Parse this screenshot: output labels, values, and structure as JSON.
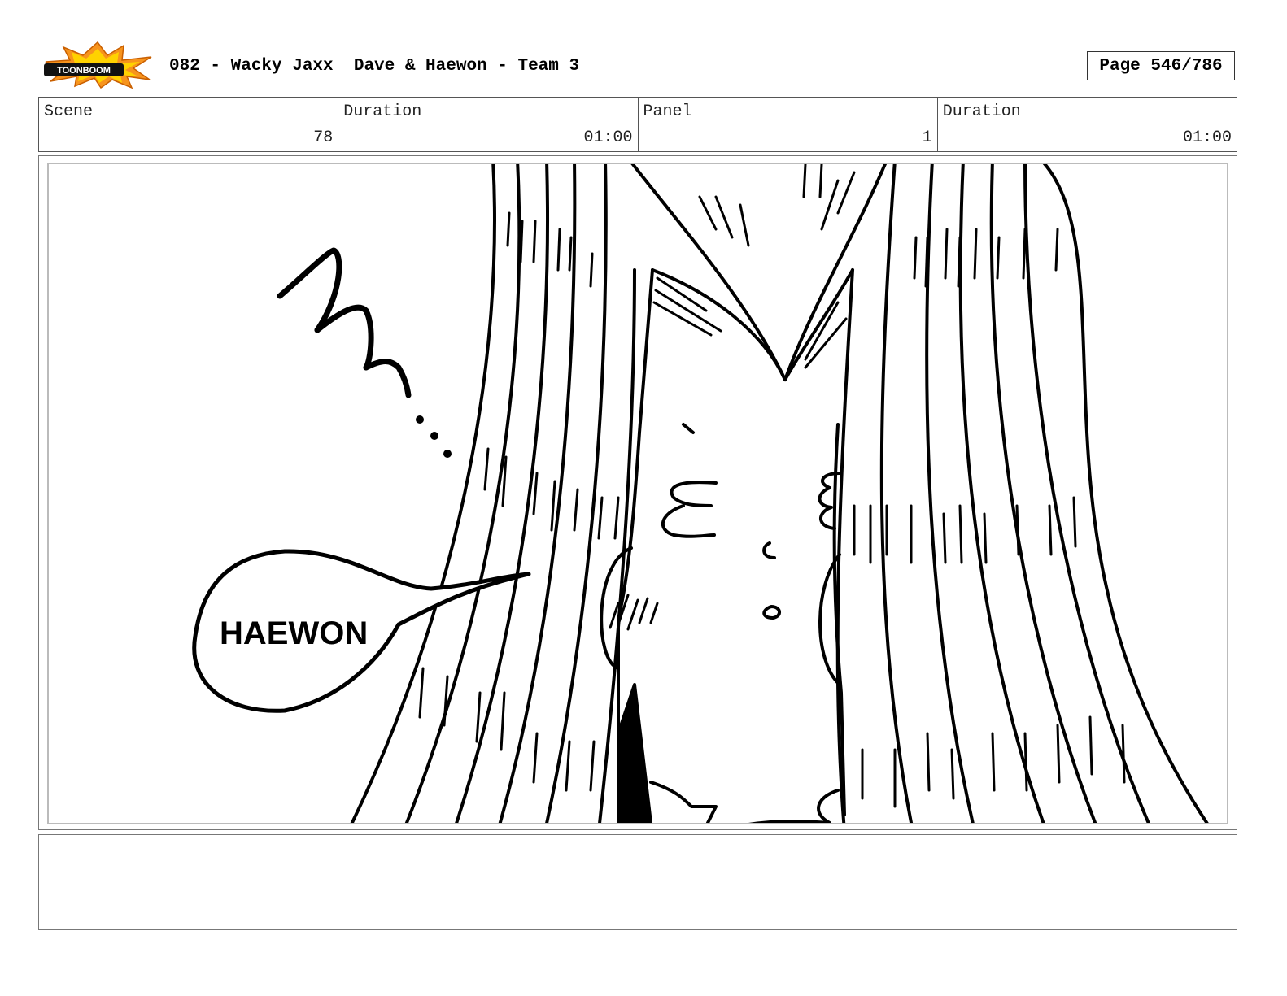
{
  "header": {
    "logo_text": "TOONBOOM",
    "title": "082 - Wacky Jaxx  Dave & Haewon - Team 3",
    "page_label": "Page 546/786"
  },
  "info": {
    "scene_label": "Scene",
    "scene_value": "78",
    "duration_label": "Duration",
    "duration_value": "01:00",
    "panel_label": "Panel",
    "panel_value": "1",
    "panel_duration_label": "Duration",
    "panel_duration_value": "01:00"
  },
  "panel": {
    "sfx_text": "ʌʌʌ...",
    "speech_text": "HAEWON"
  },
  "notes": {
    "text": ""
  },
  "colors": {
    "logo_orange": "#f7941d",
    "logo_yellow": "#ffd200",
    "line": "#000000",
    "border": "#555555"
  }
}
